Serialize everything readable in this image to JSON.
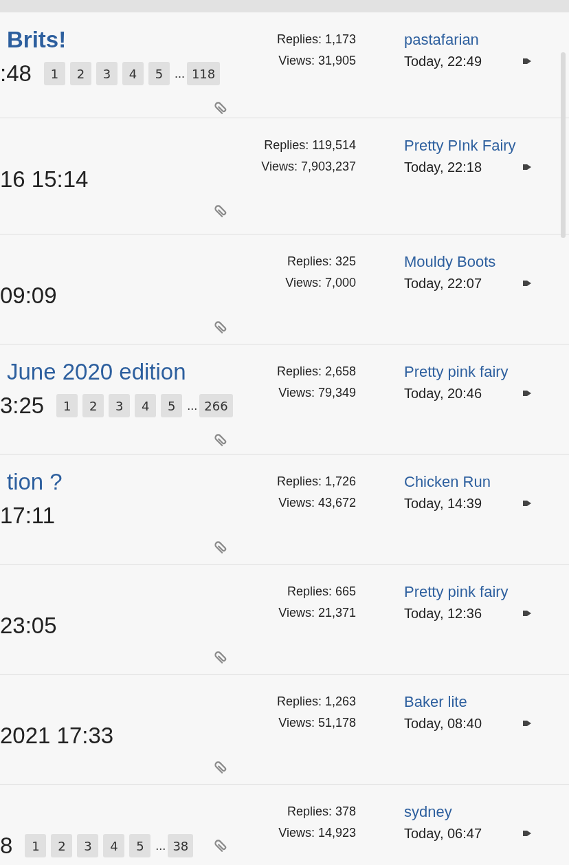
{
  "topics": [
    {
      "title": "Brits!",
      "title_bold": true,
      "date": ":48",
      "pages": [
        "1",
        "2",
        "3",
        "4",
        "5",
        "118"
      ],
      "ellipsis": "...",
      "replies": "Replies: 1,173",
      "views": "Views: 31,905",
      "last_poster": "pastafarian",
      "last_time": "Today, 22:49"
    },
    {
      "date": "16 15:14",
      "replies": "Replies: 119,514",
      "views": "Views: 7,903,237",
      "last_poster": "Pretty PInk Fairy",
      "last_time": "Today, 22:18"
    },
    {
      "date": "09:09",
      "replies": "Replies: 325",
      "views": "Views: 7,000",
      "last_poster": "Mouldy Boots",
      "last_time": "Today, 22:07"
    },
    {
      "title": "June 2020 edition",
      "title_bold": false,
      "date": "3:25",
      "pages": [
        "1",
        "2",
        "3",
        "4",
        "5",
        "266"
      ],
      "ellipsis": "...",
      "replies": "Replies: 2,658",
      "views": "Views: 79,349",
      "last_poster": "Pretty pink fairy",
      "last_time": "Today, 20:46"
    },
    {
      "title": "tion ?",
      "title_bold": false,
      "date": "17:11",
      "replies": "Replies: 1,726",
      "views": "Views: 43,672",
      "last_poster": "Chicken Run",
      "last_time": "Today, 14:39"
    },
    {
      "date": "23:05",
      "replies": "Replies: 665",
      "views": "Views: 21,371",
      "last_poster": "Pretty pink fairy",
      "last_time": "Today, 12:36"
    },
    {
      "date": "2021 17:33",
      "replies": "Replies: 1,263",
      "views": "Views: 51,178",
      "last_poster": "Baker lite",
      "last_time": "Today, 08:40"
    },
    {
      "date": "8",
      "pages": [
        "1",
        "2",
        "3",
        "4",
        "5",
        "38"
      ],
      "ellipsis": "...",
      "replies": "Replies: 378",
      "views": "Views: 14,923",
      "last_poster": "sydney",
      "last_time": "Today, 06:47"
    }
  ]
}
